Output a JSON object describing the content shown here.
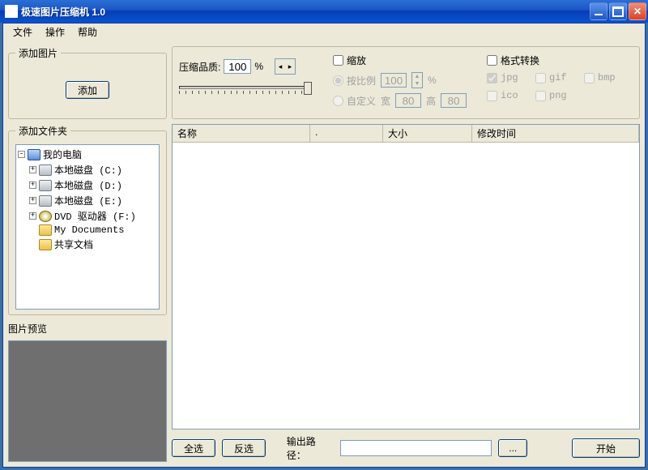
{
  "window": {
    "title": "极速图片压缩机  1.0"
  },
  "menu": {
    "file": "文件",
    "action": "操作",
    "help": "帮助"
  },
  "add_pic": {
    "legend": "添加图片",
    "button": "添加"
  },
  "quality": {
    "label": "压缩品质:",
    "value": "100",
    "percent": "%"
  },
  "scale": {
    "enable_label": "缩放",
    "enabled": false,
    "by_ratio_label": "按比例",
    "ratio_value": "100",
    "ratio_percent": "%",
    "custom_label": "自定义",
    "width_label": "宽",
    "width_value": "80",
    "height_label": "高",
    "height_value": "80"
  },
  "format": {
    "enable_label": "格式转换",
    "enabled": false,
    "jpg": "jpg",
    "gif": "gif",
    "bmp": "bmp",
    "ico": "ico",
    "png": "png",
    "jpg_checked": true
  },
  "folder": {
    "legend": "添加文件夹",
    "tree": {
      "root": "我的电脑",
      "children": [
        {
          "label": "本地磁盘 (C:)",
          "icon": "drive"
        },
        {
          "label": "本地磁盘 (D:)",
          "icon": "drive"
        },
        {
          "label": "本地磁盘 (E:)",
          "icon": "drive"
        },
        {
          "label": "DVD 驱动器 (F:)",
          "icon": "dvd"
        },
        {
          "label": "My Documents",
          "icon": "folder",
          "leaf": true
        },
        {
          "label": "共享文档",
          "icon": "folder",
          "leaf": true
        }
      ]
    }
  },
  "preview": {
    "label": "图片预览"
  },
  "list": {
    "columns": [
      "名称",
      ".",
      "大小",
      "修改时间"
    ],
    "rows": []
  },
  "bottom": {
    "select_all": "全选",
    "invert": "反选",
    "path_label": "输出路径：",
    "path_value": "",
    "browse": "...",
    "start": "开始"
  }
}
